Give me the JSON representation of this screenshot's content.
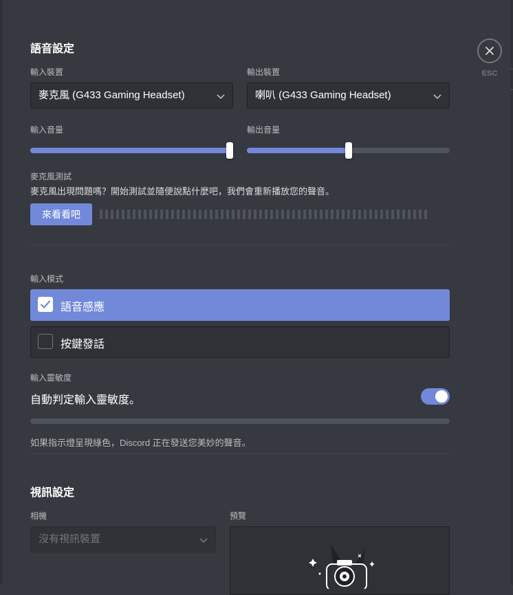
{
  "voice": {
    "title": "語音設定",
    "input_device_label": "輸入裝置",
    "input_device_value": "麥克風 (G433 Gaming Headset)",
    "output_device_label": "輸出裝置",
    "output_device_value": "喇叭 (G433 Gaming Headset)",
    "input_volume_label": "輸入音量",
    "input_volume_level": 1.0,
    "output_volume_label": "輸出音量",
    "output_volume_level": 0.5,
    "mic_test_label": "麥克風測試",
    "mic_test_desc": "麥克風出現問題嗎？開始測試並隨便說點什麼吧，我們會重新播放您的聲音。",
    "mic_test_button": "來看看吧"
  },
  "input_mode": {
    "label": "輸入模式",
    "options": [
      {
        "label": "語音感應",
        "selected": true
      },
      {
        "label": "按鍵發話",
        "selected": false
      }
    ]
  },
  "sensitivity": {
    "label": "輸入靈敏度",
    "auto_label": "自動判定輸入靈敏度。",
    "auto_enabled": true,
    "hint": "如果指示燈呈現綠色，Discord 正在發送您美妙的聲音。"
  },
  "video": {
    "title": "視訊設定",
    "camera_label": "相機",
    "camera_value": "沒有視訊裝置",
    "preview_label": "預覽"
  },
  "close": {
    "label": "ESC"
  },
  "colors": {
    "accent": "#7289da",
    "background": "#36393f",
    "input_bg": "#2f3136"
  },
  "icons": {
    "close": "close-icon",
    "chevron": "chevron-down-icon",
    "check": "check-icon",
    "camera_illustration": "camera-illustration"
  }
}
